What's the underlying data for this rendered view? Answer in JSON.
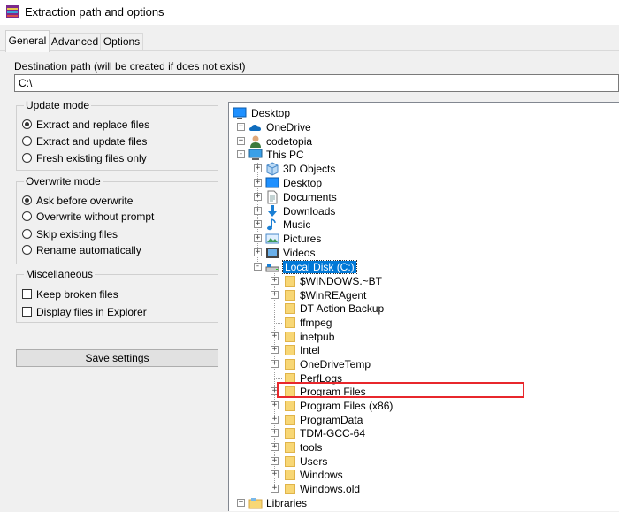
{
  "window": {
    "title": "Extraction path and options"
  },
  "tabs": [
    {
      "label": "General",
      "active": true
    },
    {
      "label": "Advanced",
      "active": false
    },
    {
      "label": "Options",
      "active": false
    }
  ],
  "destination": {
    "label": "Destination path (will be created if does not exist)",
    "value": "C:\\"
  },
  "update_mode": {
    "title": "Update mode",
    "options": [
      {
        "label": "Extract and replace files",
        "checked": true
      },
      {
        "label": "Extract and update files",
        "checked": false
      },
      {
        "label": "Fresh existing files only",
        "checked": false
      }
    ]
  },
  "overwrite_mode": {
    "title": "Overwrite mode",
    "options": [
      {
        "label": "Ask before overwrite",
        "checked": true
      },
      {
        "label": "Overwrite without prompt",
        "checked": false
      },
      {
        "label": "Skip existing files",
        "checked": false
      },
      {
        "label": "Rename automatically",
        "checked": false
      }
    ]
  },
  "misc": {
    "title": "Miscellaneous",
    "options": [
      {
        "label": "Keep broken files",
        "checked": false
      },
      {
        "label": "Display files in Explorer",
        "checked": false
      }
    ]
  },
  "save_settings_label": "Save settings",
  "tree": {
    "root": {
      "label": "Desktop",
      "icon": "desktop-icon"
    },
    "top": [
      {
        "label": "OneDrive",
        "icon": "cloud-icon",
        "expander": "+"
      },
      {
        "label": "codetopia",
        "icon": "user-icon",
        "expander": "+"
      },
      {
        "label": "This PC",
        "icon": "computer-icon",
        "expander": "-"
      }
    ],
    "this_pc": [
      {
        "label": "3D Objects",
        "icon": "cube-icon",
        "expander": "+"
      },
      {
        "label": "Desktop",
        "icon": "desktop-icon",
        "expander": "+"
      },
      {
        "label": "Documents",
        "icon": "document-icon",
        "expander": "+"
      },
      {
        "label": "Downloads",
        "icon": "download-icon",
        "expander": "+"
      },
      {
        "label": "Music",
        "icon": "music-icon",
        "expander": "+"
      },
      {
        "label": "Pictures",
        "icon": "picture-icon",
        "expander": "+"
      },
      {
        "label": "Videos",
        "icon": "video-icon",
        "expander": "+"
      },
      {
        "label": "Local Disk (C:)",
        "icon": "drive-icon",
        "expander": "-",
        "selected": true
      }
    ],
    "local_disk": [
      {
        "label": "$WINDOWS.~BT",
        "expander": "+"
      },
      {
        "label": "$WinREAgent",
        "expander": "+"
      },
      {
        "label": "DT Action Backup",
        "expander": ""
      },
      {
        "label": "ffmpeg",
        "expander": ""
      },
      {
        "label": "inetpub",
        "expander": "+"
      },
      {
        "label": "Intel",
        "expander": "+"
      },
      {
        "label": "OneDriveTemp",
        "expander": "+"
      },
      {
        "label": "PerfLogs",
        "expander": ""
      },
      {
        "label": "Program Files",
        "expander": "+",
        "highlighted": true
      },
      {
        "label": "Program Files (x86)",
        "expander": "+"
      },
      {
        "label": "ProgramData",
        "expander": "+"
      },
      {
        "label": "TDM-GCC-64",
        "expander": "+"
      },
      {
        "label": "tools",
        "expander": "+"
      },
      {
        "label": "Users",
        "expander": "+"
      },
      {
        "label": "Windows",
        "expander": "+"
      },
      {
        "label": "Windows.old",
        "expander": "+"
      }
    ],
    "bottom": [
      {
        "label": "Libraries",
        "icon": "library-icon",
        "expander": "+"
      }
    ]
  },
  "colors": {
    "selection": "#0078d7",
    "highlight_box": "#e8272c",
    "folder": "#f8d775"
  }
}
